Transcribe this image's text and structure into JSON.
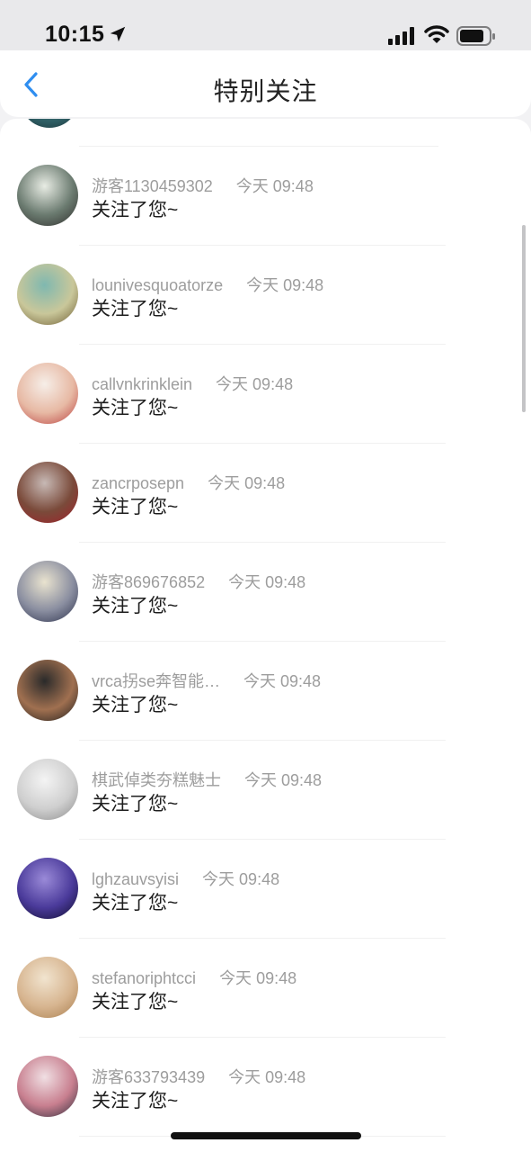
{
  "status": {
    "time": "10:15"
  },
  "nav": {
    "title": "特别关注"
  },
  "items": [
    {
      "name": "游客1130459302",
      "time": "今天 09:48",
      "message": "关注了您~",
      "colors": [
        "#e8ece4",
        "#6b7b70",
        "#2d2b2a"
      ]
    },
    {
      "name": "lounivesquoatorze",
      "time": "今天 09:48",
      "message": "关注了您~",
      "colors": [
        "#7fb8b0",
        "#c9c79a",
        "#6c5a30"
      ]
    },
    {
      "name": "callvnkrinklein",
      "time": "今天 09:48",
      "message": "关注了您~",
      "colors": [
        "#f6eee8",
        "#e7b9a4",
        "#b93c3c"
      ]
    },
    {
      "name": "zancrposepn",
      "time": "今天 09:48",
      "message": "关注了您~",
      "colors": [
        "#c7b9b5",
        "#7a4a3a",
        "#a11f2a"
      ]
    },
    {
      "name": "游客869676852",
      "time": "今天 09:48",
      "message": "关注了您~",
      "colors": [
        "#e9e3cf",
        "#8a8ea0",
        "#2a2f4a"
      ]
    },
    {
      "name": "vrca拐se奔智能…",
      "time": "今天 09:48",
      "message": "关注了您~",
      "colors": [
        "#2a2a2a",
        "#a07050",
        "#1a1a1a"
      ]
    },
    {
      "name": "棋武倬类夯糕魅士",
      "time": "今天 09:48",
      "message": "关注了您~",
      "colors": [
        "#f4f4f4",
        "#cfcfcf",
        "#8a8a8a"
      ]
    },
    {
      "name": "lghzauvsyisi",
      "time": "今天 09:48",
      "message": "关注了您~",
      "colors": [
        "#9a8ad8",
        "#4a3a9a",
        "#0e0b2a"
      ]
    },
    {
      "name": "stefanoriphtcci",
      "time": "今天 09:48",
      "message": "关注了您~",
      "colors": [
        "#f1e4cf",
        "#d7b590",
        "#a87d4d"
      ]
    },
    {
      "name": "游客633793439",
      "time": "今天 09:48",
      "message": "关注了您~",
      "colors": [
        "#f0dfe3",
        "#c87f8f",
        "#2b2b3a"
      ]
    }
  ]
}
